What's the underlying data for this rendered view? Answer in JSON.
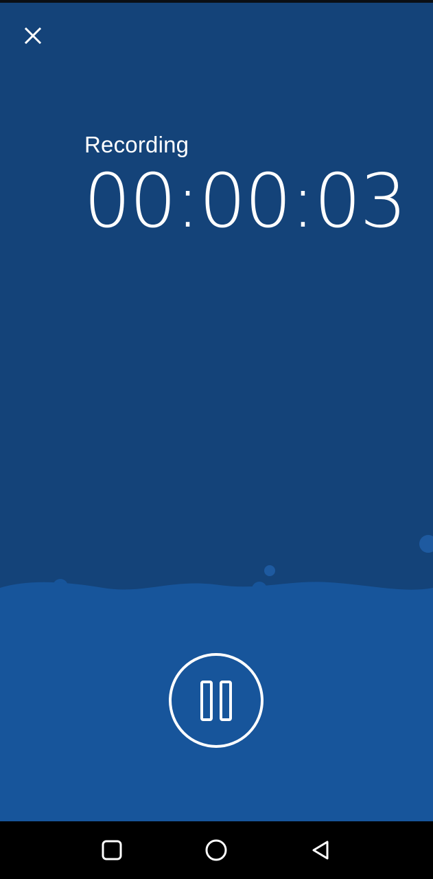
{
  "header": {
    "close_icon": "close-icon"
  },
  "recorder": {
    "status_label": "Recording",
    "elapsed_time": "00:00:03",
    "pause_icon": "pause-icon"
  },
  "navigation": {
    "recents_icon": "square-icon",
    "home_icon": "circle-icon",
    "back_icon": "triangle-back-icon"
  },
  "colors": {
    "background": "#144379",
    "water": "#17559b",
    "bubbles": "#1e5aa0",
    "foreground": "#ffffff",
    "nav_bar": "#000000"
  }
}
